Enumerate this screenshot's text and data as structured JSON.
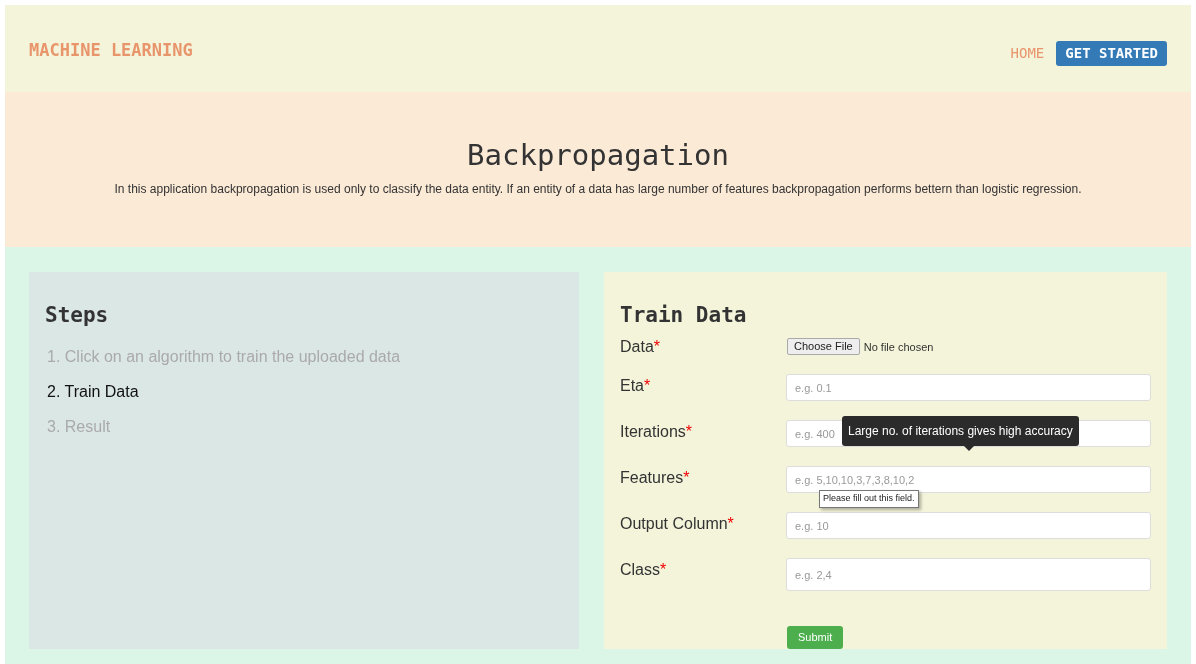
{
  "header": {
    "brand": "MACHINE LEARNING",
    "nav": [
      {
        "label": "HOME",
        "kind": "link"
      },
      {
        "label": "GET STARTED",
        "kind": "button"
      }
    ]
  },
  "hero": {
    "title": "Backpropagation",
    "description": "In this application backpropagation is used only to classify the data entity. If an entity of a data has large number of features backpropagation performs bettern than logistic regression."
  },
  "steps": {
    "title": "Steps",
    "items": [
      {
        "number": "1.",
        "label": "Click on an algorithm to train the uploaded data",
        "selected": false
      },
      {
        "number": "2.",
        "label": "Train Data",
        "selected": true
      },
      {
        "number": "3.",
        "label": "Result",
        "selected": false
      }
    ]
  },
  "form": {
    "title": "Train Data",
    "required_mark": "*",
    "fields": [
      {
        "label": "Data",
        "kind": "file",
        "button": "Choose File",
        "status": "No file chosen"
      },
      {
        "label": "Eta",
        "kind": "text",
        "placeholder": "e.g. 0.1"
      },
      {
        "label": "Iterations",
        "kind": "text",
        "placeholder": "e.g. 400",
        "tooltip": "Large no. of iterations gives high accuracy"
      },
      {
        "label": "Features",
        "kind": "text",
        "placeholder": "e.g. 5,10,10,3,7,3,8,10,2",
        "validation_message": "Please fill out this field."
      },
      {
        "label": "Output Column",
        "kind": "text",
        "placeholder": "e.g. 10"
      },
      {
        "label": "Class",
        "kind": "tall",
        "placeholder": "e.g. 2,4"
      }
    ],
    "submit": "Submit"
  }
}
